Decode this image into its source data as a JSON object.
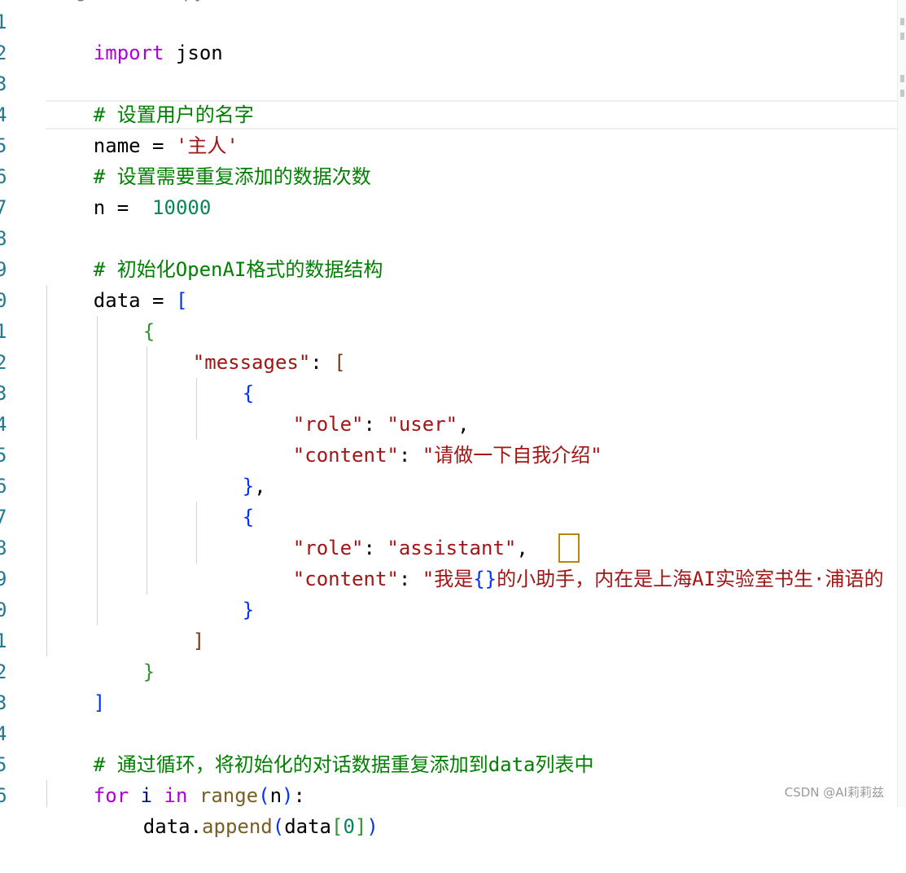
{
  "editor": {
    "top_clipped_text": "··· g······ ··py",
    "line_numbers": [
      "1",
      "2",
      "3",
      "4",
      "5",
      "6",
      "7",
      "8",
      "9",
      "0",
      "1",
      "2",
      "3",
      "4",
      "5",
      "6",
      "7",
      "8",
      "9",
      "0",
      "1",
      "2",
      "3",
      "4",
      "5",
      "6"
    ],
    "lines": {
      "l1_kw": "import",
      "l1_rest": " json",
      "l3_comment": "# 设置用户的名字",
      "l4_var": "name",
      "l4_eq": " = ",
      "l4_str": "'主人'",
      "l5_comment": "# 设置需要重复添加的数据次数",
      "l6_var": "n",
      "l6_eq": " =  ",
      "l6_num": "10000",
      "l8_comment": "# 初始化OpenAI格式的数据结构",
      "l9_var": "data",
      "l9_eq": " = ",
      "l9_bracket": "[",
      "l10_brace": "{",
      "l11_key": "\"messages\"",
      "l11_colon": ": ",
      "l11_bracket": "[",
      "l12_brace": "{",
      "l13_key": "\"role\"",
      "l13_colon": ": ",
      "l13_val": "\"user\"",
      "l13_comma": ",",
      "l14_key": "\"content\"",
      "l14_colon": ": ",
      "l14_val": "\"请做一下自我介绍\"",
      "l15_brace": "}",
      "l15_comma": ",",
      "l16_brace": "{",
      "l17_key": "\"role\"",
      "l17_colon": ": ",
      "l17_val": "\"assistant\"",
      "l17_comma": ",",
      "l18_key": "\"content\"",
      "l18_colon": ": ",
      "l18_val_a": "\"我是",
      "l18_braces": "{}",
      "l18_val_b": "的小助手，内在是上海AI实验室书生·浦语的",
      "l19_brace": "}",
      "l20_bracket": "]",
      "l21_brace": "}",
      "l22_bracket": "]",
      "l24_comment": "# 通过循环，将初始化的对话数据重复添加到data列表中",
      "l25_for": "for",
      "l25_i": " i ",
      "l25_in": "in",
      "l25_sp": " ",
      "l25_range": "range",
      "l25_paren_open": "(",
      "l25_n": "n",
      "l25_paren_close": ")",
      "l25_colon": ":",
      "l26_data": "data",
      "l26_dot": ".",
      "l26_append": "append",
      "l26_po": "(",
      "l26_arg": "data",
      "l26_bo": "[",
      "l26_idx": "0",
      "l26_bc": "]",
      "l26_pc": ")"
    }
  },
  "watermark": "CSDN @AI莉莉兹",
  "colors": {
    "keyword": "#af00db",
    "comment": "#008000",
    "string": "#a31515",
    "number": "#098658",
    "bracket_level1": "#0431fa",
    "bracket_level2": "#319331",
    "bracket_level3": "#7b3814",
    "function": "#795e26"
  }
}
